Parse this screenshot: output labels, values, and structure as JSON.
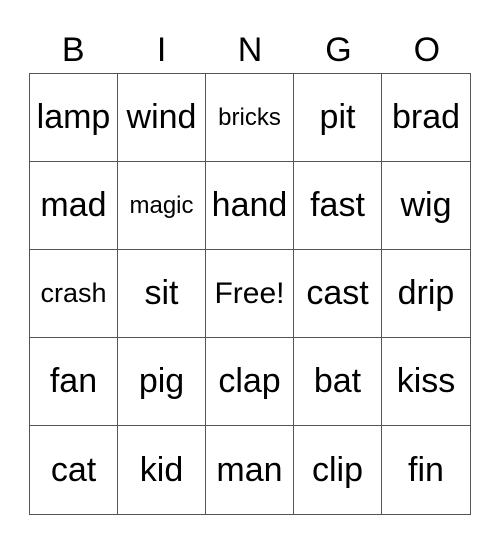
{
  "header": [
    "B",
    "I",
    "N",
    "G",
    "O"
  ],
  "grid": [
    [
      "lamp",
      "wind",
      "bricks",
      "pit",
      "brad"
    ],
    [
      "mad",
      "magic",
      "hand",
      "fast",
      "wig"
    ],
    [
      "crash",
      "sit",
      "Free!",
      "cast",
      "drip"
    ],
    [
      "fan",
      "pig",
      "clap",
      "bat",
      "kiss"
    ],
    [
      "cat",
      "kid",
      "man",
      "clip",
      "fin"
    ]
  ]
}
